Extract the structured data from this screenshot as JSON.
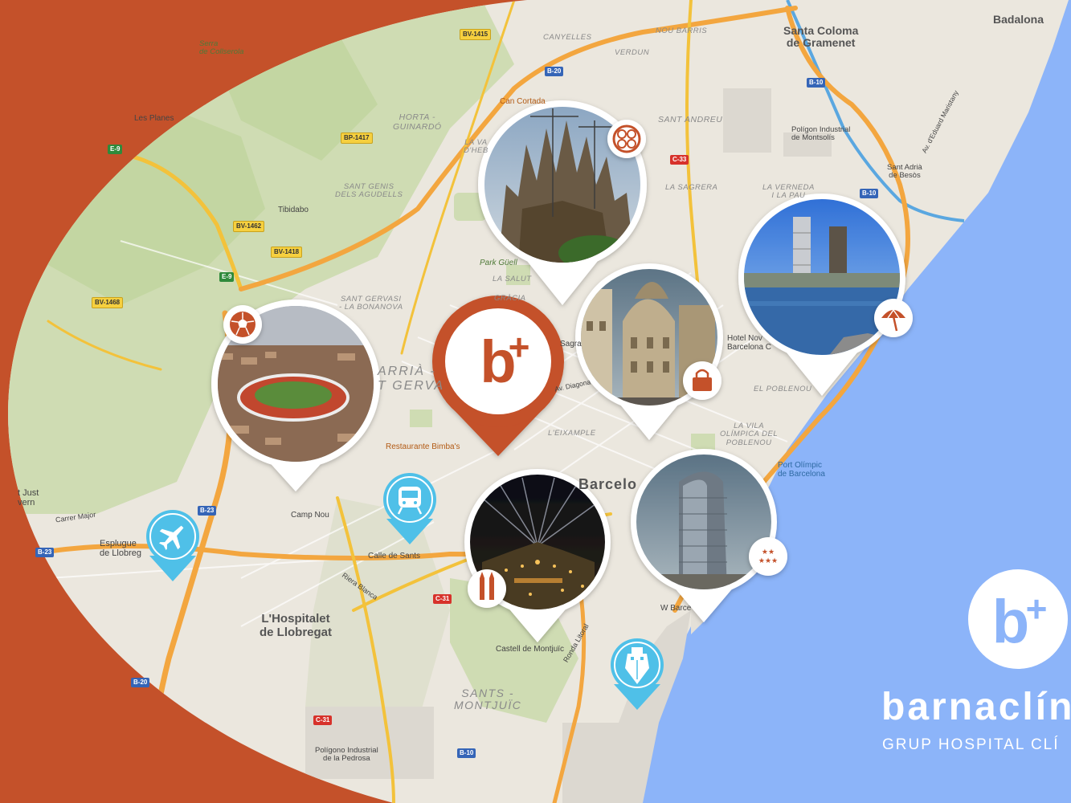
{
  "colors": {
    "background": "#c4512a",
    "land": "#ebe7de",
    "sea": "#8cb4f9",
    "park": "#c9dcaa",
    "highway": "#f3a63f",
    "pin_brand": "#c4512a",
    "pin_transport": "#4fc0e8",
    "pin_white": "#ffffff"
  },
  "map": {
    "place_labels": {
      "badalona": "Badalona",
      "santa_coloma": "Santa Coloma\nde Gramenet",
      "poligon_montsolis": "Polígon Industrial\nde Montsolís",
      "sant_adria": "Sant Adrià\nde Besòs",
      "barcelona": "Barcelo",
      "hospitalet": "L'Hospitalet\nde Llobregat",
      "esplugues": "Esplugue\nde Llobreg",
      "sant_just": "t Just\nvern",
      "les_planes": "Les Planes",
      "tibidabo": "Tibidabo",
      "serra_collserola": "Serra\nde Collserola",
      "poligono_pedrosa": "Polígono Industrial\nde la Pedrosa"
    },
    "district_labels": {
      "horta": "HORTA -\nGUINARDÓ",
      "canyelles": "CANYELLES",
      "nou_barris": "NOU BARRIS",
      "verdun": "VERDUN",
      "sant_andreu": "SANT ANDREU",
      "la_sagrera": "LA SAGRERA",
      "la_verneda": "LA VERNEDA\nI LA PAU",
      "sant_gervasi_agudells": "SANT GENIS\nDELS AGUDELLS",
      "la_vall": "LA VA\nD'HEB",
      "la_salut": "LA SALUT",
      "gracia": "GRÀCIA",
      "sant_gervasi_bonanova": "SANT GERVASI\n- LA BONANOVA",
      "sarria": "ARRIÀ -\nT GERVA",
      "eixample": "L'EIXAMPLE",
      "poblenou": "EL POBLENOU",
      "vila_olimpica": "LA VILA\nOLÍMPICA DEL\nPOBLENOU",
      "sants_montjuic": "SANTS -\nMONTJUÏC"
    },
    "poi_labels": {
      "can_cortada": "Can Cortada",
      "park_guell": "Park Güell",
      "sagrada": "Sagra",
      "diagonal": "Av. Diagona",
      "hotel_nova": "Hotel Nov\nBarcelona C",
      "restaurante_bimba": "Restaurante Bimba's",
      "camp_nou": "Camp Nou",
      "port_olimpic": "Port Olímpic\nde Barcelona",
      "w_barcelona": "W Barce",
      "castell_montjuic": "Castell de Montjuïc",
      "ronda_litoral": "Ronda Litoral",
      "carrer_major": "Carrer Major",
      "calle_sants": "Calle de Sants",
      "riera_blanca": "Riera Blanca",
      "eduard_maristany": "Av. d'Eduard Maristany"
    },
    "road_shields": {
      "bv1415": "BV-1415",
      "b20_top": "B-20",
      "bp1417": "BP-1417",
      "b10_a": "B-10",
      "b10_b": "B-10",
      "c33": "C-33",
      "e9_a": "E-9",
      "bv1462": "BV-1462",
      "bv1418": "BV-1418",
      "e9_b": "E-9",
      "bv1468": "BV-1468",
      "b23_a": "B-23",
      "b23_b": "B-23",
      "b20_bottom": "B-20",
      "c31_a": "C-31",
      "c31_b": "C-31",
      "b10_c": "B-10"
    }
  },
  "markers": [
    {
      "name": "brand-location-pin",
      "icon": "barnaclinic-b-plus-icon",
      "label": "b+"
    },
    {
      "name": "sagrada-familia-photo-pin",
      "icon": "flower-emblem-icon"
    },
    {
      "name": "camp-nou-photo-pin",
      "icon": "football-icon"
    },
    {
      "name": "shopping-photo-pin",
      "icon": "shopping-bag-icon"
    },
    {
      "name": "beach-photo-pin",
      "icon": "beach-umbrella-icon"
    },
    {
      "name": "montjuic-photo-pin",
      "icon": "twin-towers-icon"
    },
    {
      "name": "hotel-w-photo-pin",
      "icon": "three-stars-icon",
      "label": "★★\n★★★"
    },
    {
      "name": "airport-pin",
      "icon": "airplane-icon"
    },
    {
      "name": "train-station-pin",
      "icon": "train-icon"
    },
    {
      "name": "cruise-port-pin",
      "icon": "ship-icon"
    }
  ],
  "brand": {
    "logo_mark": "b+",
    "name": "barnaclín",
    "tagline": "GRUP HOSPITAL CLÍ"
  }
}
